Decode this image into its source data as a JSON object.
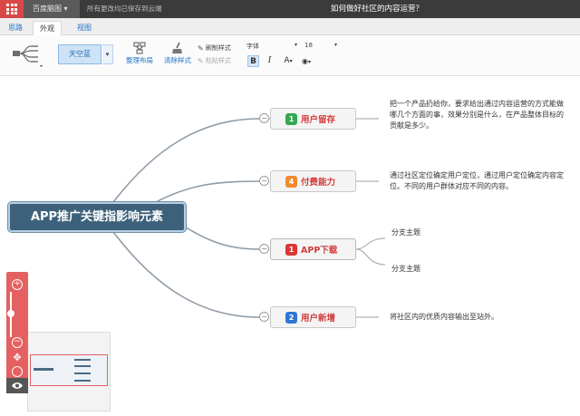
{
  "app": {
    "brand": "百度脑图 ▾",
    "save_status": "所有更改均已保存到云端",
    "title": "如何做好社区的内容运营？"
  },
  "tabs": [
    {
      "label": "思路"
    },
    {
      "label": "外观"
    },
    {
      "label": "视图"
    }
  ],
  "toolbar": {
    "theme_label": "天空蓝",
    "theme_dropdown": "▾",
    "arrange_label": "整理布局",
    "clear_style_label": "清除样式",
    "copy_style_label": "刷制样式",
    "paste_style_label": "粘贴样式",
    "font_family": "字体",
    "font_size": "18",
    "bold_label": "B",
    "italic_label": "I",
    "font_color_label": "A",
    "bg_color_label": "◉"
  },
  "mindmap": {
    "root": "APP推广关键指影响元素",
    "branches": [
      {
        "index": "1",
        "label": "用户留存",
        "color": "#33a852"
      },
      {
        "index": "4",
        "label": "付费能力",
        "color": "#f08c2e"
      },
      {
        "index": "1",
        "label": "APP下载",
        "color": "#d93636"
      },
      {
        "index": "2",
        "label": "用户新增",
        "color": "#2e76d6"
      }
    ],
    "leaves": {
      "retention": "把一个产品扔给你，要求给出通过内容运营的方式能做哪几个方面的事，效果分别是什么，在产品整体目标的贡献是多少。",
      "payment": "通过社区定位确定用户定位，通过用户定位确定内容定位。不同的用户群体对应不同的内容。",
      "download_1": "分支主题",
      "download_2": "分支主题",
      "new_users": "将社区内的优质内容输出至站外。"
    },
    "collapse_symbol": "−"
  },
  "zoom": {
    "zoom_in": "+",
    "zoom_out": "−",
    "reset": "✥"
  }
}
